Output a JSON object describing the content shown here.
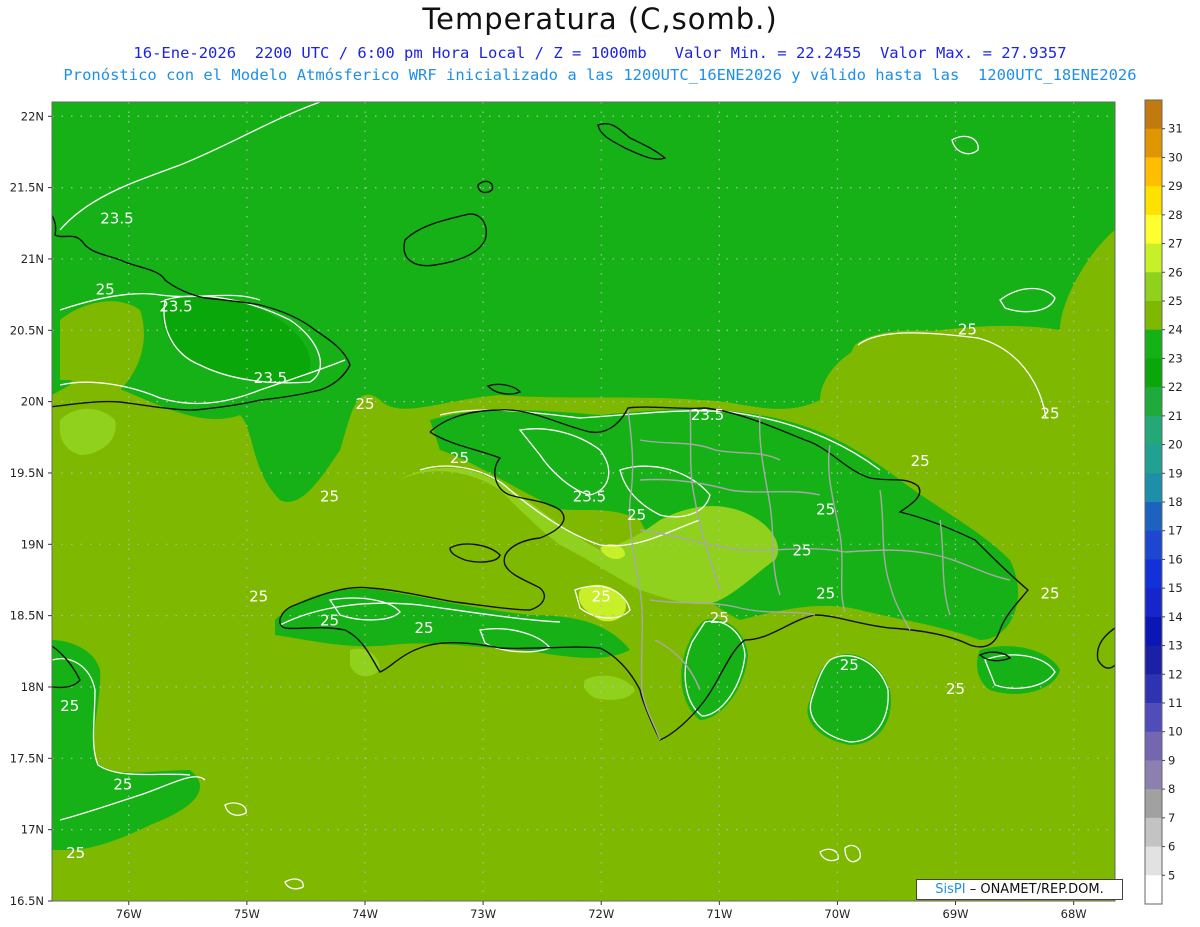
{
  "title": "Temperatura (C,somb.)",
  "subtitle_line1": "16-Ene-2026  2200 UTC / 6:00 pm Hora Local / Z = 1000mb   Valor Min. = 22.2455  Valor Max. = 27.9357",
  "subtitle_line2": "Pronóstico con el Modelo Atmósferico WRF inicializado a las 1200UTC_16ENE2026 y válido hasta las  1200UTC_18ENE2026",
  "credit": {
    "brand": "SisPI",
    "text": " – ONAMET/REP.DOM."
  },
  "axes": {
    "lat_labels": [
      "22N",
      "21.5N",
      "21N",
      "20.5N",
      "20N",
      "19.5N",
      "19N",
      "18.5N",
      "18N",
      "17.5N",
      "17N",
      "16.5N"
    ],
    "lon_labels": [
      "76W",
      "75W",
      "74W",
      "73W",
      "72W",
      "71W",
      "70W",
      "69W",
      "68W"
    ],
    "lat_range": [
      16.5,
      22.1
    ],
    "lon_range": [
      -76.65,
      -67.65
    ]
  },
  "colorbar": {
    "labels": [
      "31",
      "30",
      "29",
      "28",
      "27",
      "26",
      "25",
      "24",
      "23",
      "22",
      "21",
      "20",
      "19",
      "18",
      "17",
      "16",
      "15",
      "14",
      "13",
      "12",
      "11",
      "10",
      "9",
      "8",
      "7",
      "6",
      "5"
    ],
    "colors": [
      "#c07a10",
      "#e19500",
      "#ffbf00",
      "#ffe100",
      "#ffff30",
      "#c8f028",
      "#8fd11c",
      "#7fb800",
      "#16b116",
      "#0aa70a",
      "#1faa3c",
      "#24a878",
      "#21a193",
      "#1e8fa8",
      "#1e62c0",
      "#1d47d0",
      "#1231d8",
      "#1726cb",
      "#0b16b4",
      "#1a21a5",
      "#2e33b2",
      "#504cb8",
      "#7466b0",
      "#8d7fb0",
      "#a1a1a1",
      "#c3c3c3",
      "#e2e2e2",
      "#ffffff"
    ]
  },
  "contour_labels": [
    {
      "text": "23.5",
      "lon": -76.1,
      "lat": 21.25
    },
    {
      "text": "25",
      "lon": -76.2,
      "lat": 20.75
    },
    {
      "text": "23.5",
      "lon": -75.6,
      "lat": 20.63
    },
    {
      "text": "23.5",
      "lon": -74.8,
      "lat": 20.13
    },
    {
      "text": "25",
      "lon": -74.0,
      "lat": 19.95
    },
    {
      "text": "25",
      "lon": -74.3,
      "lat": 19.3
    },
    {
      "text": "25",
      "lon": -73.2,
      "lat": 19.57
    },
    {
      "text": "23.5",
      "lon": -72.1,
      "lat": 19.3
    },
    {
      "text": "25",
      "lon": -71.7,
      "lat": 19.17
    },
    {
      "text": "23.5",
      "lon": -71.1,
      "lat": 19.87
    },
    {
      "text": "25",
      "lon": -70.1,
      "lat": 19.21
    },
    {
      "text": "25",
      "lon": -70.3,
      "lat": 18.92
    },
    {
      "text": "25",
      "lon": -69.3,
      "lat": 19.55
    },
    {
      "text": "25",
      "lon": -68.9,
      "lat": 20.47
    },
    {
      "text": "25",
      "lon": -68.2,
      "lat": 19.88
    },
    {
      "text": "25",
      "lon": -74.9,
      "lat": 18.6
    },
    {
      "text": "25",
      "lon": -74.3,
      "lat": 18.43
    },
    {
      "text": "25",
      "lon": -73.5,
      "lat": 18.38
    },
    {
      "text": "25",
      "lon": -72.0,
      "lat": 18.6
    },
    {
      "text": "25",
      "lon": -71.0,
      "lat": 18.45
    },
    {
      "text": "25",
      "lon": -70.1,
      "lat": 18.62
    },
    {
      "text": "25",
      "lon": -69.9,
      "lat": 18.12
    },
    {
      "text": "25",
      "lon": -68.2,
      "lat": 18.62
    },
    {
      "text": "25",
      "lon": -69.0,
      "lat": 17.95
    },
    {
      "text": "25",
      "lon": -76.5,
      "lat": 17.83
    },
    {
      "text": "25",
      "lon": -76.05,
      "lat": 17.28
    },
    {
      "text": "25",
      "lon": -76.45,
      "lat": 16.8
    }
  ]
}
